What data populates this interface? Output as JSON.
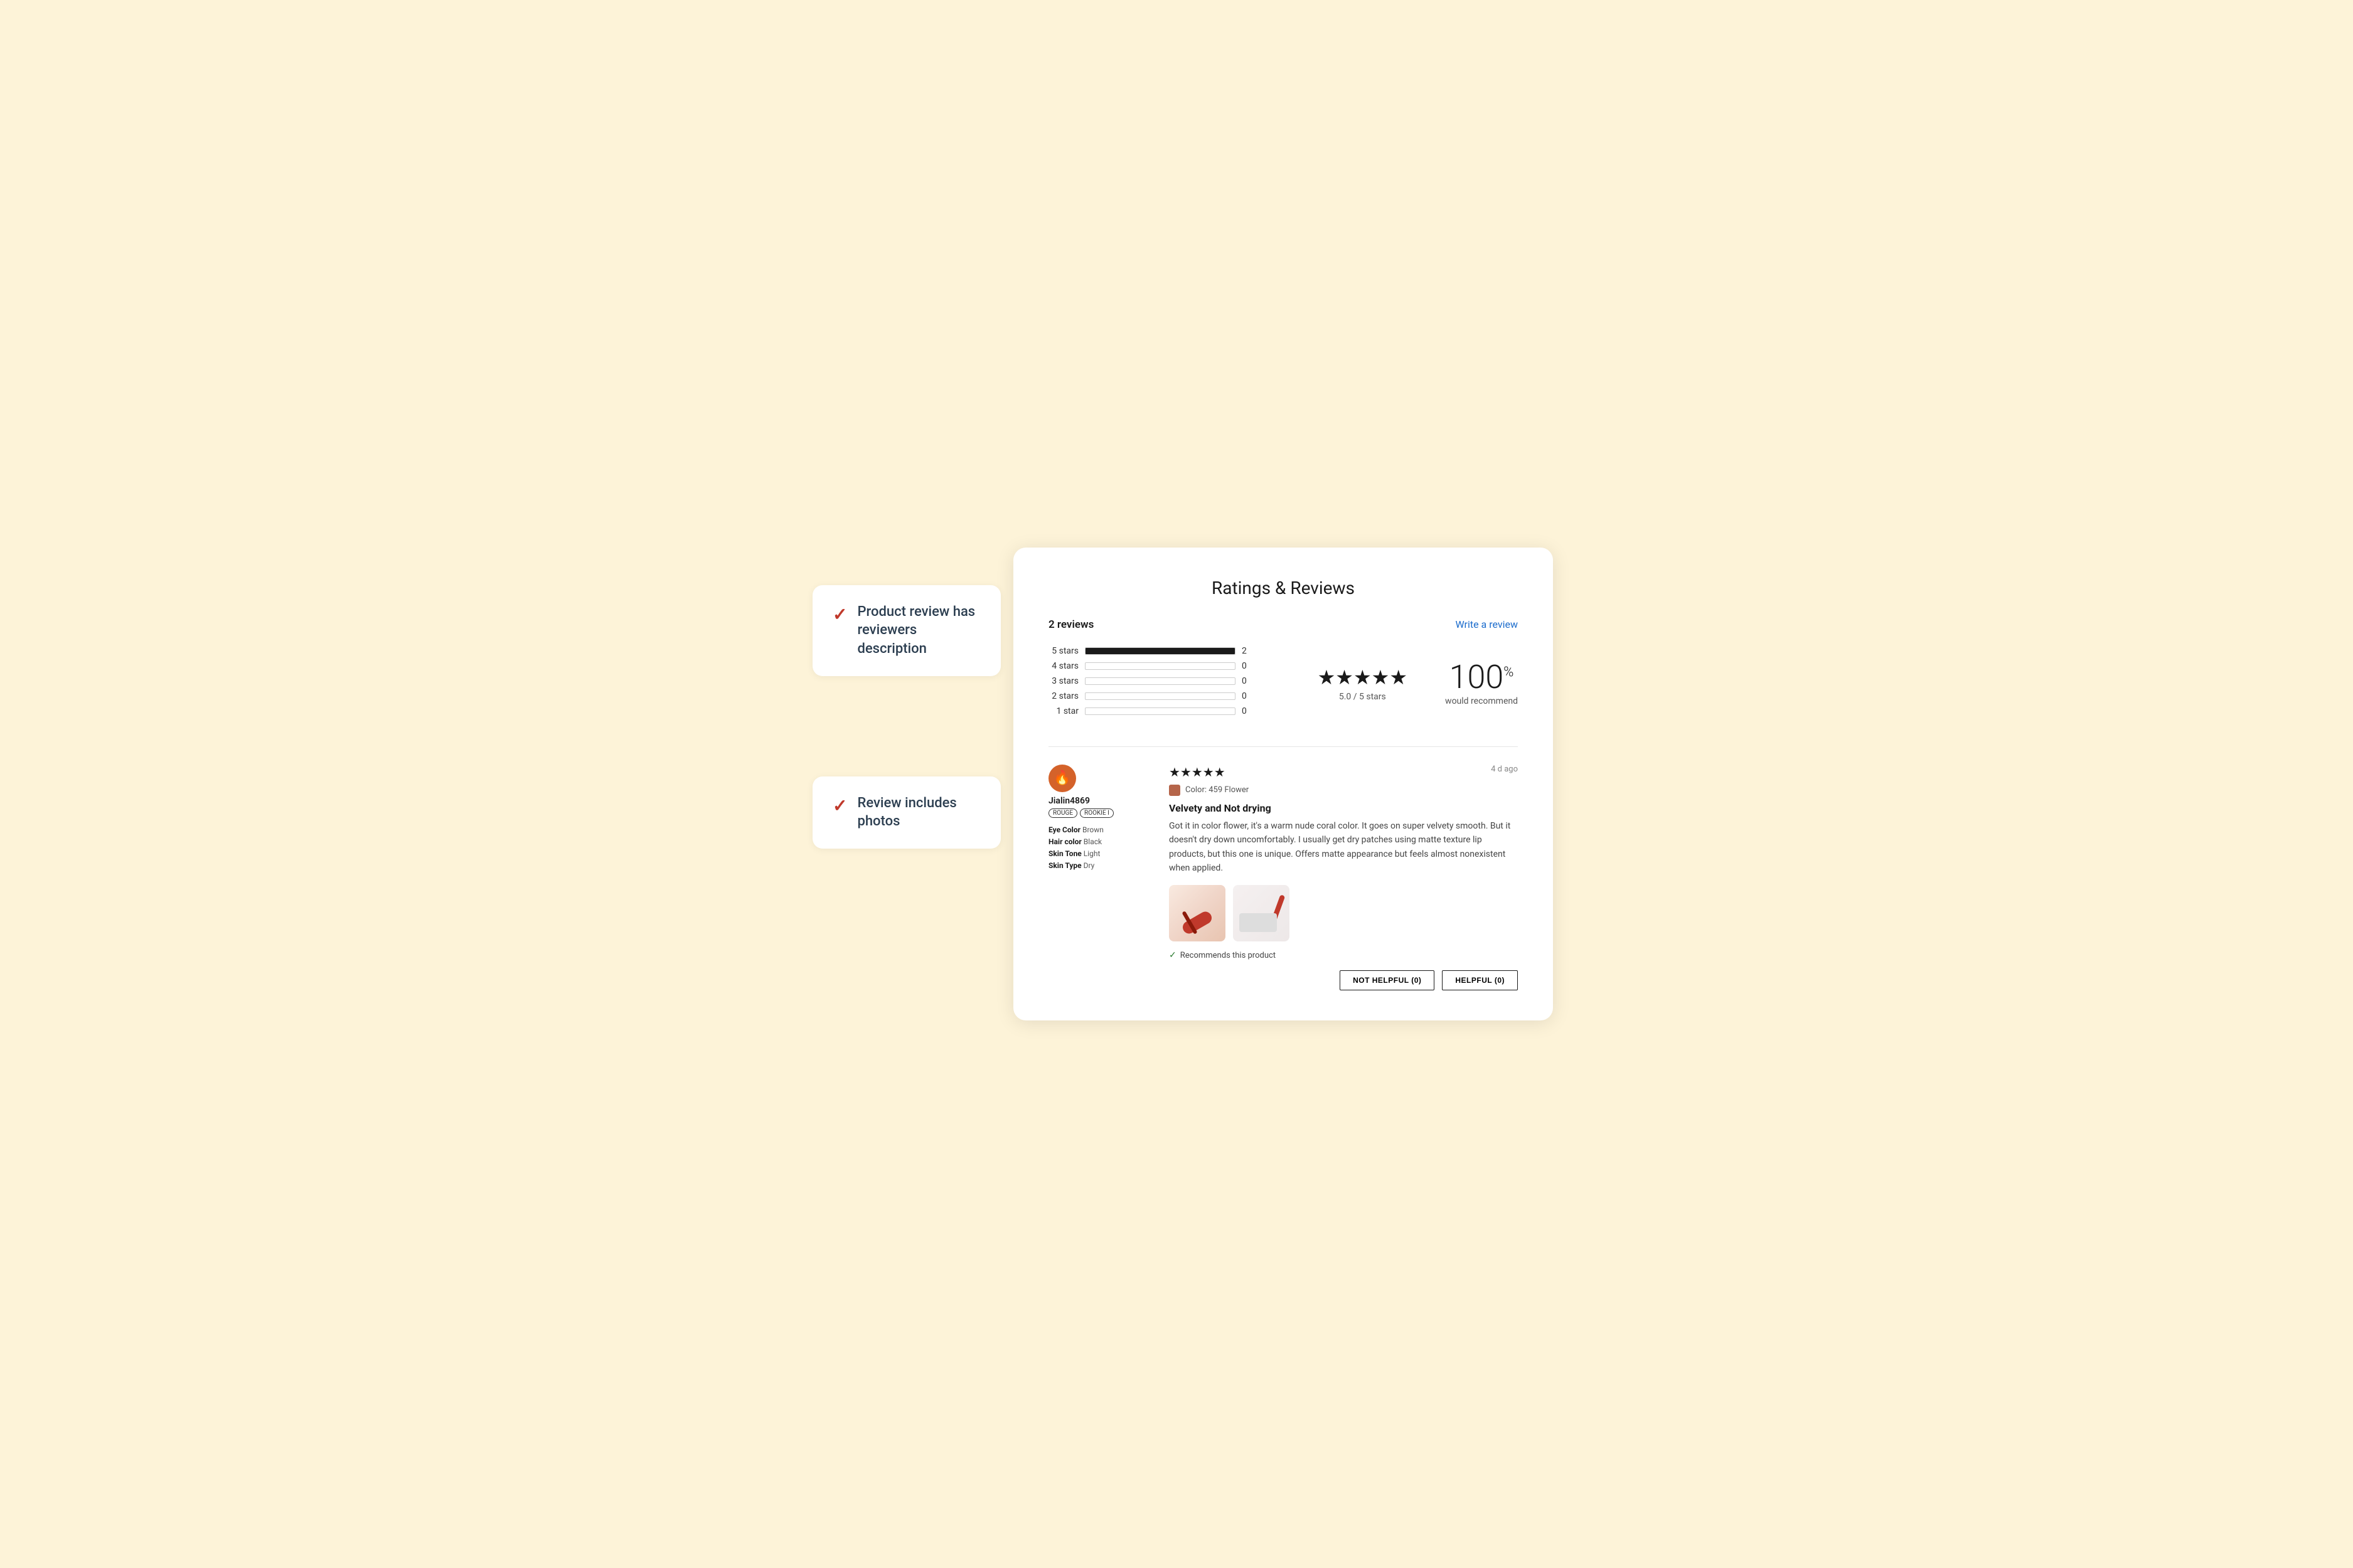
{
  "background_color": "#fdf3d8",
  "annotations": [
    {
      "id": "annotation-1",
      "text": "Product review has reviewers description",
      "check": "✓"
    },
    {
      "id": "annotation-2",
      "text": "Review includes photos",
      "check": "✓"
    }
  ],
  "main_card": {
    "title": "Ratings & Reviews",
    "reviews_count": "2 reviews",
    "write_review_label": "Write a review",
    "star_rows": [
      {
        "label": "5 stars",
        "fill_pct": 100,
        "count": "2"
      },
      {
        "label": "4 stars",
        "fill_pct": 0,
        "count": "0"
      },
      {
        "label": "3 stars",
        "fill_pct": 0,
        "count": "0"
      },
      {
        "label": "2 stars",
        "fill_pct": 0,
        "count": "0"
      },
      {
        "label": "1 star",
        "fill_pct": 0,
        "count": "0"
      }
    ],
    "overall_rating": "5.0 / 5 stars",
    "recommend_pct": "100",
    "recommend_pct_symbol": "%",
    "recommend_label": "would recommend",
    "review": {
      "reviewer_name": "Jialin4869",
      "reviewer_avatar_emoji": "🔥",
      "badges": [
        "ROUGE",
        "ROOKIE I"
      ],
      "attrs": [
        {
          "key": "Eye Color",
          "value": "Brown"
        },
        {
          "key": "Hair color",
          "value": "Black"
        },
        {
          "key": "Skin Tone",
          "value": "Light"
        },
        {
          "key": "Skin Type",
          "value": "Dry"
        }
      ],
      "stars": "★★★★★",
      "date": "4 d ago",
      "color_label": "Color: 459 Flower",
      "review_title": "Velvety and Not drying",
      "review_body": "Got it in color flower, it's a warm nude coral color. It goes on super velvety smooth. But it doesn't dry down uncomfortably. I usually get dry patches using matte texture lip products, but this one is unique. Offers matte appearance but feels almost nonexistent when applied.",
      "recommends_text": "Recommends this product",
      "not_helpful_label": "NOT HELPFUL (0)",
      "helpful_label": "HELPFUL (0)"
    }
  }
}
